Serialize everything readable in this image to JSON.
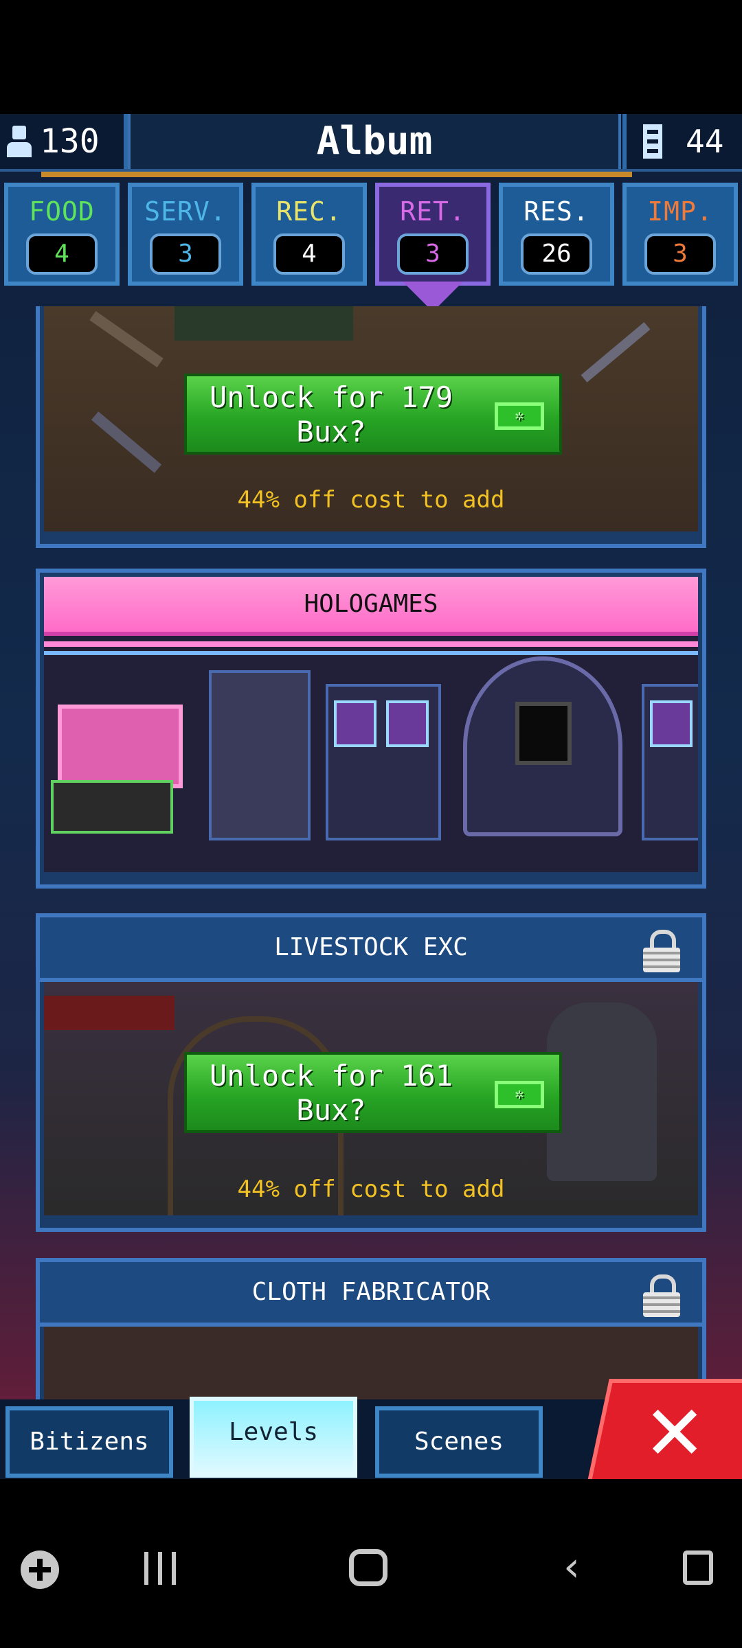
{
  "header": {
    "population": "130",
    "title": "Album",
    "floors": "44"
  },
  "categories": [
    {
      "label": "FOOD",
      "count": "4",
      "color": "#5fe35a"
    },
    {
      "label": "SERV.",
      "count": "3",
      "color": "#4fb6e8"
    },
    {
      "label": "REC.",
      "count": "4",
      "color": "#e9e36a"
    },
    {
      "label": "RET.",
      "count": "3",
      "color": "#d86ae8"
    },
    {
      "label": "RES.",
      "count": "26",
      "color": "#ffffff"
    },
    {
      "label": "IMP.",
      "count": "3",
      "color": "#f07a3a"
    }
  ],
  "active_category": "RET.",
  "cards": [
    {
      "name": "",
      "locked": true,
      "unlock_label": "Unlock for 179 Bux?",
      "discount": "44% off cost to add"
    },
    {
      "name": "HOLOGAMES",
      "locked": false
    },
    {
      "name": "LIVESTOCK EXC",
      "locked": true,
      "unlock_label": "Unlock for 161 Bux?",
      "discount": "44% off cost to add"
    },
    {
      "name": "CLOTH FABRICATOR",
      "locked": true
    }
  ],
  "bottom_tabs": {
    "bitizens": "Bitizens",
    "levels": "Levels",
    "scenes": "Scenes"
  },
  "active_bottom_tab": "Levels",
  "system_nav": [
    "game-launcher-icon",
    "recents-icon",
    "home-icon",
    "back-icon",
    "screenshot-lock-icon"
  ]
}
